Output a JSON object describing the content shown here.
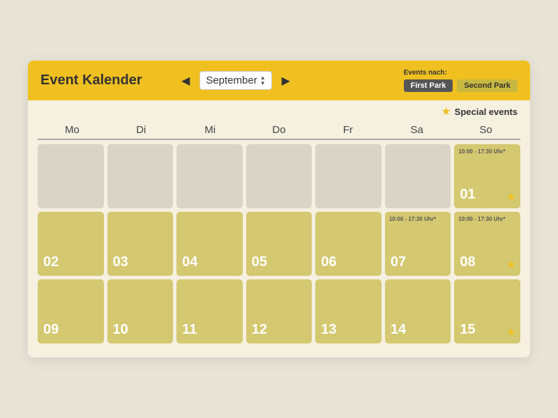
{
  "header": {
    "title": "Event Kalender",
    "month": "September",
    "events_nach_label": "Events nach:",
    "park_buttons": [
      {
        "label": "First Park",
        "state": "active"
      },
      {
        "label": "Second Park",
        "state": "inactive"
      }
    ]
  },
  "special_events": {
    "label": "Special events"
  },
  "day_headers": [
    "Mo",
    "Di",
    "Mi",
    "Do",
    "Fr",
    "Sa",
    "So"
  ],
  "weeks": [
    {
      "days": [
        {
          "number": null,
          "empty": true
        },
        {
          "number": null,
          "empty": true
        },
        {
          "number": null,
          "empty": true
        },
        {
          "number": null,
          "empty": true
        },
        {
          "number": null,
          "empty": true
        },
        {
          "number": null,
          "empty": true
        },
        {
          "number": "01",
          "empty": false,
          "event_time": "10:00 - 17:30 Uhr*",
          "star": true
        }
      ]
    },
    {
      "days": [
        {
          "number": "02",
          "empty": false,
          "event_time": null,
          "star": false
        },
        {
          "number": "03",
          "empty": false,
          "event_time": null,
          "star": false
        },
        {
          "number": "04",
          "empty": false,
          "event_time": null,
          "star": false
        },
        {
          "number": "05",
          "empty": false,
          "event_time": null,
          "star": false
        },
        {
          "number": "06",
          "empty": false,
          "event_time": null,
          "star": false
        },
        {
          "number": "07",
          "empty": false,
          "event_time": "10:00 - 17:30 Uhr*",
          "star": false
        },
        {
          "number": "08",
          "empty": false,
          "event_time": "10:00 - 17:30 Uhr*",
          "star": true
        }
      ]
    },
    {
      "days": [
        {
          "number": "09",
          "empty": false,
          "event_time": null,
          "star": false
        },
        {
          "number": "10",
          "empty": false,
          "event_time": null,
          "star": false
        },
        {
          "number": "11",
          "empty": false,
          "event_time": null,
          "star": false
        },
        {
          "number": "12",
          "empty": false,
          "event_time": null,
          "star": false
        },
        {
          "number": "13",
          "empty": false,
          "event_time": null,
          "star": false
        },
        {
          "number": "14",
          "empty": false,
          "event_time": null,
          "star": false
        },
        {
          "number": "15",
          "empty": false,
          "event_time": null,
          "star": true
        }
      ]
    }
  ],
  "nav": {
    "prev_label": "◀",
    "next_label": "▶"
  }
}
